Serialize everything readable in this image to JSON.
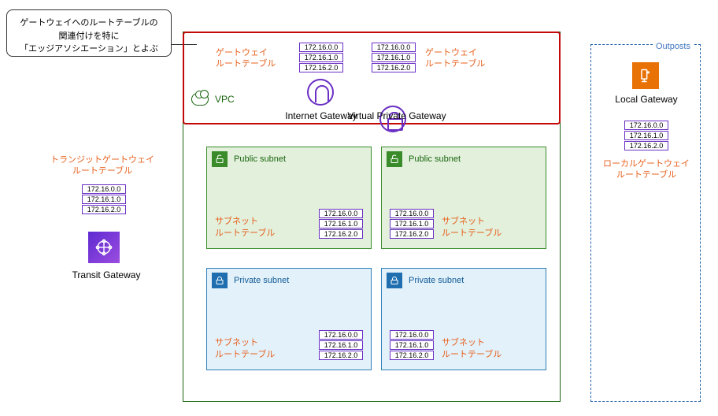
{
  "callout": "ゲートウェイへのルートテーブルの\n関連付けを特に\n「エッジアソシエーション」とよぶ",
  "vpc": "VPC",
  "gw_label": "ゲートウェイ\nルートテーブル",
  "igw": "Internet Gateway",
  "vgw": "Virtual Private Gateway",
  "routes": [
    "172.16.0.0",
    "172.16.1.0",
    "172.16.2.0"
  ],
  "pub_title": "Public subnet",
  "prv_title": "Private subnet",
  "subnet_rt": "サブネット\nルートテーブル",
  "tgw_label": "トランジットゲートウェイ\nルートテーブル",
  "tgw": "Transit Gateway",
  "outposts": "Outposts",
  "lgw": "Local Gateway",
  "lgw_label": "ローカルゲートウェイ\nルートテーブル"
}
